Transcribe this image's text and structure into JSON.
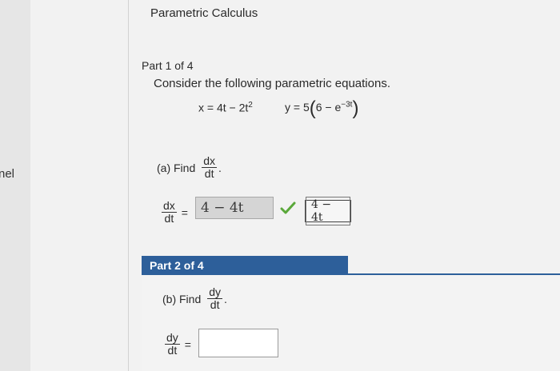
{
  "app": {
    "title": "Parametric Calculus",
    "left_label": "nel"
  },
  "part1": {
    "heading": "Part 1 of 4",
    "prompt": "Consider the following parametric equations.",
    "eq_x": "x = 4t − 2t",
    "eq_x_exp": "2",
    "eq_y_prefix": "y = 5",
    "eq_y_inner": "6 − e",
    "eq_y_exp": "−3t",
    "part_a_label": "(a) Find",
    "frac_num": "dx",
    "frac_den": "dt",
    "answer_value": "4 − 4t",
    "correct_value": "4 − 4t"
  },
  "part2": {
    "bar_label": "Part 2 of 4",
    "part_b_label": "(b) Find",
    "frac_num": "dy",
    "frac_den": "dt",
    "answer_value": ""
  },
  "colors": {
    "accent": "#2d5f9a",
    "check": "#5aa83a"
  }
}
